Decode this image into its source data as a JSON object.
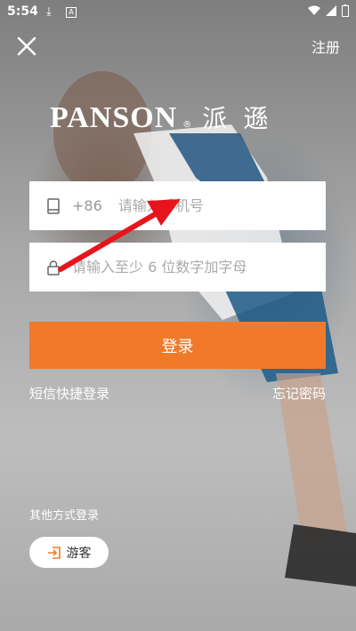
{
  "status_bar": {
    "time": "5:54"
  },
  "header": {
    "register_label": "注册"
  },
  "brand": {
    "latin": "PANSON",
    "reg_mark": "®",
    "chinese": "派遜"
  },
  "phone_field": {
    "prefix": "+86",
    "placeholder": "请输入手机号"
  },
  "password_field": {
    "placeholder": "请输入至少 6 位数字加字母"
  },
  "login_button": {
    "label": "登录"
  },
  "links": {
    "sms_login": "短信快捷登录",
    "forgot_password": "忘记密码"
  },
  "other_login": {
    "label": "其他方式登录",
    "guest_label": "游客"
  },
  "colors": {
    "accent": "#f07a2a",
    "annotation_arrow": "#e8141c"
  }
}
